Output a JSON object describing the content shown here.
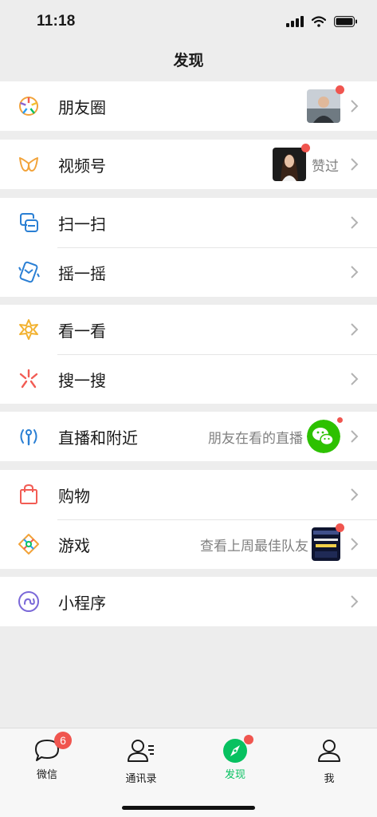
{
  "status_bar": {
    "time": "11:18"
  },
  "header": {
    "title": "发现"
  },
  "groups": [
    {
      "items": [
        {
          "label": "朋友圈",
          "icon": "moments-icon",
          "has_thumb": true,
          "has_dot": true
        }
      ]
    },
    {
      "items": [
        {
          "label": "视频号",
          "icon": "channels-icon",
          "right_text": "赞过",
          "has_thumb": true,
          "has_dot": true
        }
      ]
    },
    {
      "items": [
        {
          "label": "扫一扫",
          "icon": "scan-icon"
        },
        {
          "label": "摇一摇",
          "icon": "shake-icon"
        }
      ]
    },
    {
      "items": [
        {
          "label": "看一看",
          "icon": "top-stories-icon"
        },
        {
          "label": "搜一搜",
          "icon": "search-icon"
        }
      ]
    },
    {
      "items": [
        {
          "label": "直播和附近",
          "icon": "live-nearby-icon",
          "right_text": "朋友在看的直播",
          "has_dot": true
        }
      ]
    },
    {
      "items": [
        {
          "label": "购物",
          "icon": "shopping-bag-icon"
        },
        {
          "label": "游戏",
          "icon": "games-icon",
          "right_text": "查看上周最佳队友",
          "has_thumb": true,
          "has_dot": true
        }
      ]
    },
    {
      "items": [
        {
          "label": "小程序",
          "icon": "mini-program-icon"
        }
      ]
    }
  ],
  "tabbar": {
    "tabs": [
      {
        "label": "微信",
        "icon": "chat-bubble-icon",
        "badge": "6"
      },
      {
        "label": "通讯录",
        "icon": "contacts-icon"
      },
      {
        "label": "发现",
        "icon": "compass-icon",
        "active": true
      },
      {
        "label": "我",
        "icon": "person-icon"
      }
    ]
  },
  "colors": {
    "accent": "#07c160",
    "badge": "#f0554f",
    "background": "#ededed"
  }
}
